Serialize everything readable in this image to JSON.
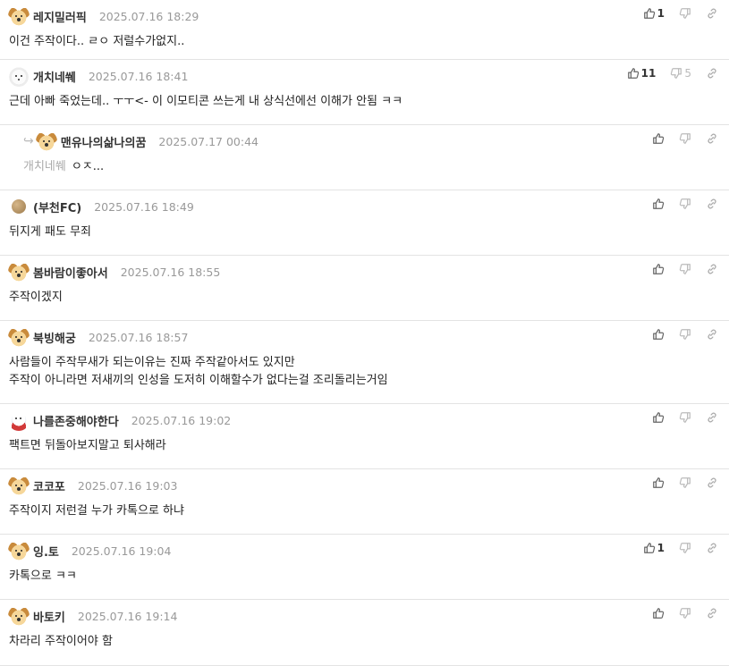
{
  "comments": [
    {
      "nick": "레지밀러픽",
      "date": "2025.07.16 18:29",
      "avatar": "dog",
      "up": "1",
      "down": "",
      "lines": [
        "이건 주작이다.. ㄹㅇ 저럴수가없지.."
      ]
    },
    {
      "nick": "개치네쒜",
      "date": "2025.07.16 18:41",
      "avatar": "white",
      "up": "11",
      "down": "5",
      "lines": [
        "근데 아빠 죽었는데.. ㅜㅜ<- 이 이모티콘 쓰는게 내 상식선에선 이해가 안됨 ㅋㅋ"
      ]
    },
    {
      "nick": "맨유나의삶나의꿈",
      "date": "2025.07.17 00:44",
      "avatar": "dog",
      "reply": true,
      "mention": "개치네쒜",
      "up": "",
      "down": "",
      "lines": [
        "ㅇㅈ..."
      ]
    },
    {
      "nick": "(부천FC)",
      "date": "2025.07.16 18:49",
      "avatar": "ball",
      "up": "",
      "down": "",
      "lines": [
        "뒤지게 패도 무죄"
      ]
    },
    {
      "nick": "봄바람이좋아서",
      "date": "2025.07.16 18:55",
      "avatar": "dog",
      "up": "",
      "down": "",
      "lines": [
        "주작이겠지"
      ]
    },
    {
      "nick": "북빙해궁",
      "date": "2025.07.16 18:57",
      "avatar": "dog",
      "up": "",
      "down": "",
      "lines": [
        "사람들이 주작무새가 되는이유는 진짜 주작같아서도 있지만",
        "주작이 아니라면 저새끼의 인성을 도저히 이해할수가 없다는걸 조리돌리는거임"
      ]
    },
    {
      "nick": "나를존중해야한다",
      "date": "2025.07.16 19:02",
      "avatar": "bear",
      "up": "",
      "down": "",
      "lines": [
        "팩트면 뒤돌아보지말고 퇴사해라"
      ]
    },
    {
      "nick": "코코포",
      "date": "2025.07.16 19:03",
      "avatar": "dog",
      "up": "",
      "down": "",
      "lines": [
        "주작이지 저런걸 누가 카톡으로 하냐"
      ]
    },
    {
      "nick": "잉.토",
      "date": "2025.07.16 19:04",
      "avatar": "dog",
      "up": "1",
      "down": "",
      "lines": [
        "카톡으로 ㅋㅋ"
      ]
    },
    {
      "nick": "바토키",
      "date": "2025.07.16 19:14",
      "avatar": "dog",
      "up": "",
      "down": "",
      "lines": [
        "차라리 주작이어야 함"
      ]
    }
  ],
  "icons": {
    "upvote": "thumbs-up-icon",
    "downvote": "thumbs-down-icon",
    "link": "link-icon",
    "reply": "reply-arrow-icon"
  },
  "colors": {
    "text": "#222222",
    "date": "#999999",
    "divider": "#e3e3e3",
    "mention": "#aaaaaa"
  }
}
